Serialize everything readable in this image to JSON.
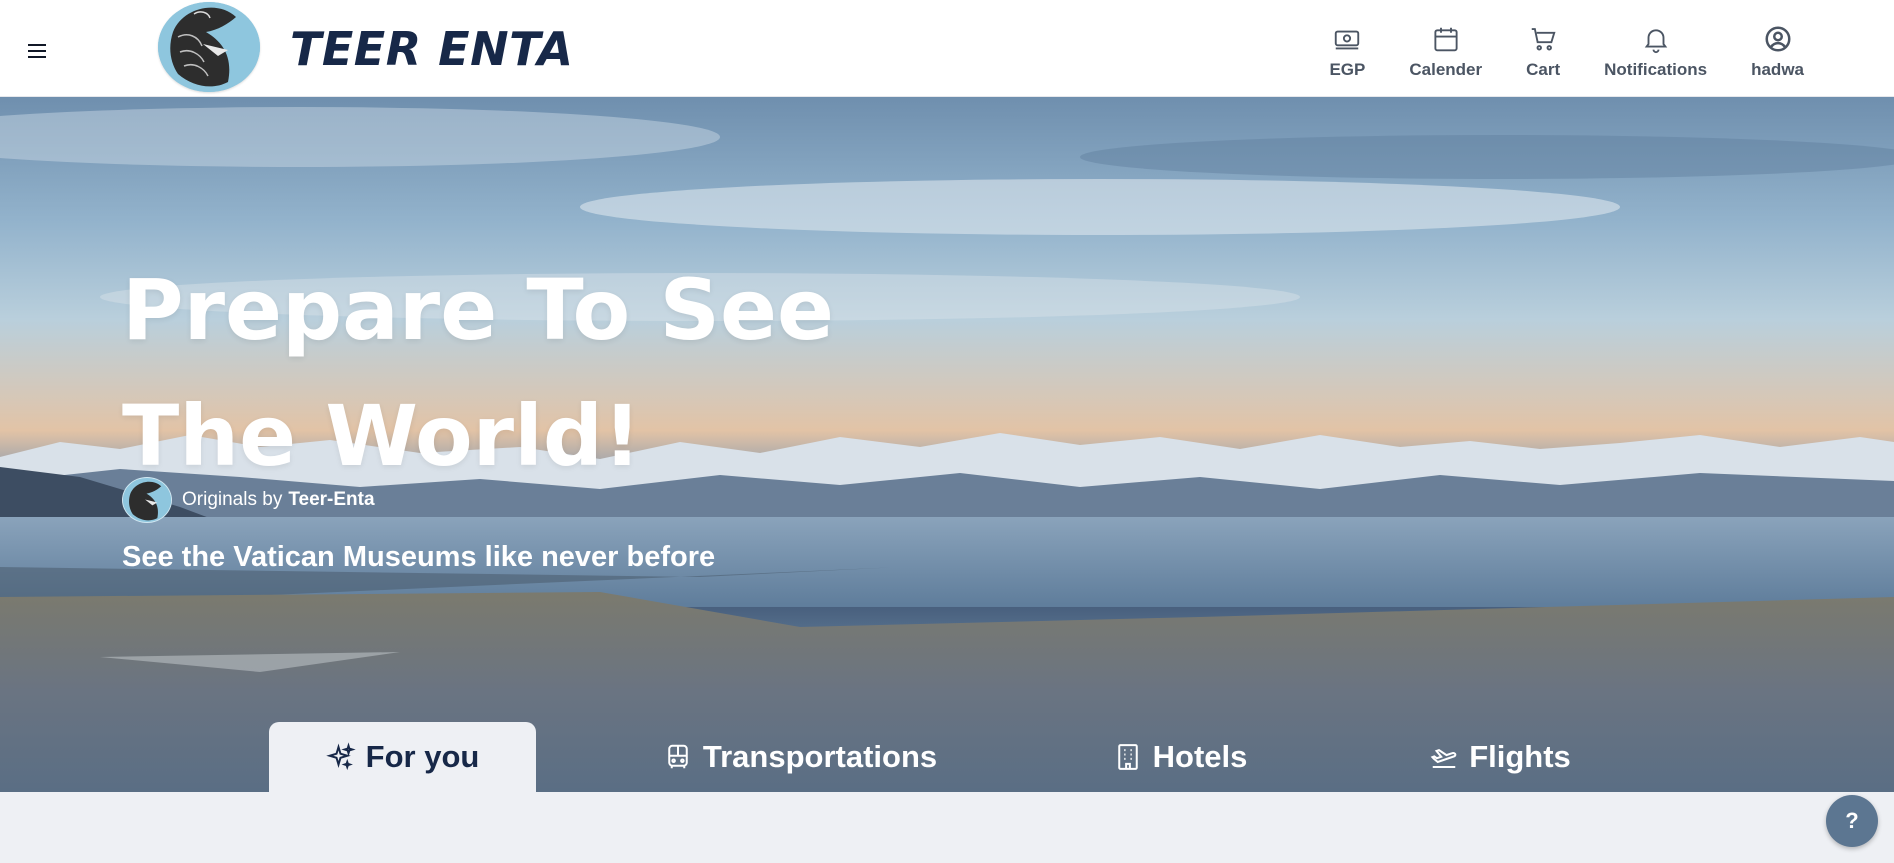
{
  "header": {
    "brand": "TEER ENTA",
    "nav": [
      {
        "label": "EGP",
        "icon": "currency-icon"
      },
      {
        "label": "Calender",
        "icon": "calendar-icon"
      },
      {
        "label": "Cart",
        "icon": "cart-icon"
      },
      {
        "label": "Notifications",
        "icon": "bell-icon"
      },
      {
        "label": "hadwa",
        "icon": "user-icon"
      }
    ]
  },
  "hero": {
    "title": "Prepare To See The World!",
    "originals_prefix": "Originals by",
    "originals_brand": "Teer-Enta",
    "tagline": "See the Vatican Museums like never before"
  },
  "tabs": [
    {
      "label": "For you",
      "icon": "sparkles-icon",
      "active": true
    },
    {
      "label": "Transportations",
      "icon": "bus-icon",
      "active": false
    },
    {
      "label": "Hotels",
      "icon": "building-icon",
      "active": false
    },
    {
      "label": "Flights",
      "icon": "plane-icon",
      "active": false
    }
  ],
  "help": {
    "label": "?"
  },
  "colors": {
    "brand": "#172848",
    "nav_text": "#4b5563",
    "page_bg": "#eef0f4",
    "help_bg": "#5c7691"
  }
}
